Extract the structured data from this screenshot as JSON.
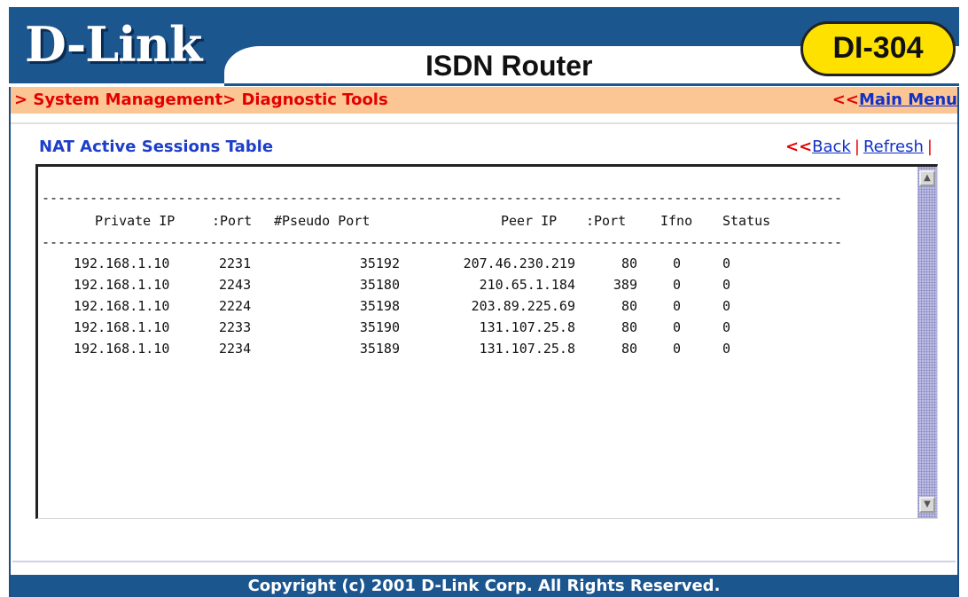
{
  "header": {
    "logo": "D-Link",
    "product": "ISDN Router",
    "model": "DI-304"
  },
  "breadcrumb": {
    "path": "> System Management> Diagnostic Tools",
    "main_menu_arrows": "<<",
    "main_menu_label": "Main Menu"
  },
  "section": {
    "title": "NAT Active Sessions Table",
    "back_arrows": "<<",
    "back_label": "Back",
    "sep1": "|",
    "refresh_label": "Refresh",
    "sep2": "|"
  },
  "table": {
    "dashes": "----------------------------------------------------------------------------------------------------",
    "headers": {
      "private_ip": "Private IP",
      "port": ":Port",
      "pseudo_port": "#Pseudo Port",
      "peer_ip": "Peer IP",
      "peer_port": ":Port",
      "ifno": "Ifno",
      "status": "Status"
    },
    "rows": [
      {
        "private_ip": "192.168.1.10",
        "port": "2231",
        "pseudo": "35192",
        "peer_ip": "207.46.230.219",
        "peer_port": "80",
        "ifno": "0",
        "status": "0"
      },
      {
        "private_ip": "192.168.1.10",
        "port": "2243",
        "pseudo": "35180",
        "peer_ip": "210.65.1.184",
        "peer_port": "389",
        "ifno": "0",
        "status": "0"
      },
      {
        "private_ip": "192.168.1.10",
        "port": "2224",
        "pseudo": "35198",
        "peer_ip": "203.89.225.69",
        "peer_port": "80",
        "ifno": "0",
        "status": "0"
      },
      {
        "private_ip": "192.168.1.10",
        "port": "2233",
        "pseudo": "35190",
        "peer_ip": "131.107.25.8",
        "peer_port": "80",
        "ifno": "0",
        "status": "0"
      },
      {
        "private_ip": "192.168.1.10",
        "port": "2234",
        "pseudo": "35189",
        "peer_ip": "131.107.25.8",
        "peer_port": "80",
        "ifno": "0",
        "status": "0"
      }
    ]
  },
  "icons": {
    "scroll_up": "scroll-up-icon",
    "scroll_down": "scroll-down-icon"
  },
  "footer": {
    "copyright": "Copyright (c) 2001 D-Link Corp. All Rights Reserved."
  },
  "colors": {
    "brand_blue": "#1c568f",
    "breadcrumb_bg": "#fcc694",
    "breadcrumb_text": "#e30000",
    "badge_yellow": "#ffe100",
    "link_blue": "#1030c8"
  }
}
